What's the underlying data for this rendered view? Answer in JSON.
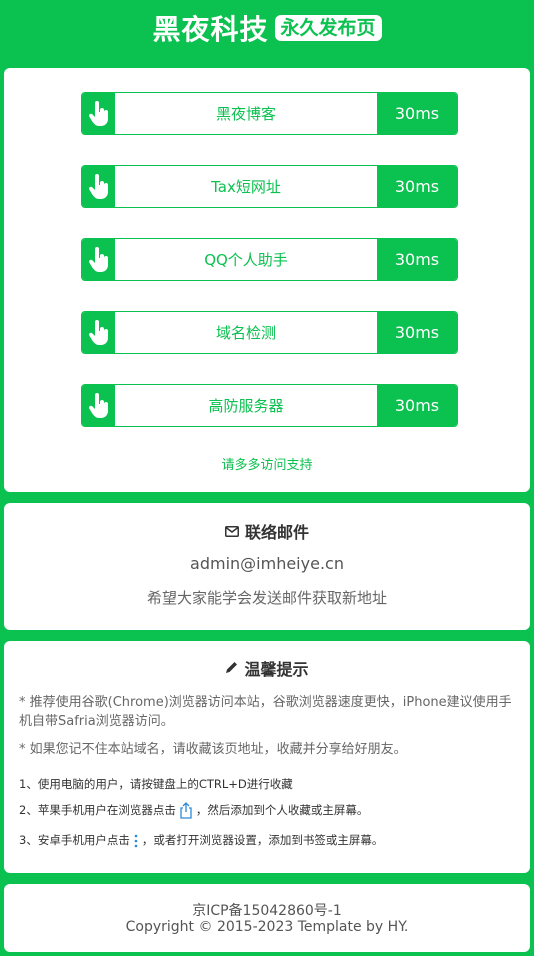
{
  "header": {
    "title": "黑夜科技",
    "badge": "永久发布页"
  },
  "links": [
    {
      "label": "黑夜博客",
      "latency": "30ms"
    },
    {
      "label": "Tax短网址",
      "latency": "30ms"
    },
    {
      "label": "QQ个人助手",
      "latency": "30ms"
    },
    {
      "label": "域名检测",
      "latency": "30ms"
    },
    {
      "label": "高防服务器",
      "latency": "30ms"
    }
  ],
  "support_text": "请多多访问支持",
  "mail": {
    "title": "联络邮件",
    "address": "admin@imheiye.cn",
    "note": "希望大家能学会发送邮件获取新地址"
  },
  "tips": {
    "title": "温馨提示",
    "line1": "* 推荐使用谷歌(Chrome)浏览器访问本站，谷歌浏览器速度更快，iPhone建议使用手机自带Safria浏览器访问。",
    "line2": "* 如果您记不住本站域名，请收藏该页地址，收藏并分享给好朋友。",
    "step1": "1、使用电脑的用户，请按键盘上的CTRL+D进行收藏",
    "step2a": "2、苹果手机用户在浏览器点击",
    "step2b": "，然后添加到个人收藏或主屏幕。",
    "step3a": "3、安卓手机用户点击",
    "step3b": "，或者打开浏览器设置，添加到书签或主屏幕。"
  },
  "footer": {
    "icp": "京ICP备15042860号-1",
    "copyright": "Copyright © 2015-2023 Template by HY."
  },
  "colors": {
    "accent": "#0bc14f"
  },
  "icons": {
    "link": "pointing-hand-icon",
    "mail": "envelope-icon",
    "tips": "pencil-icon",
    "share": "share-icon",
    "menu": "vertical-dots-icon"
  }
}
